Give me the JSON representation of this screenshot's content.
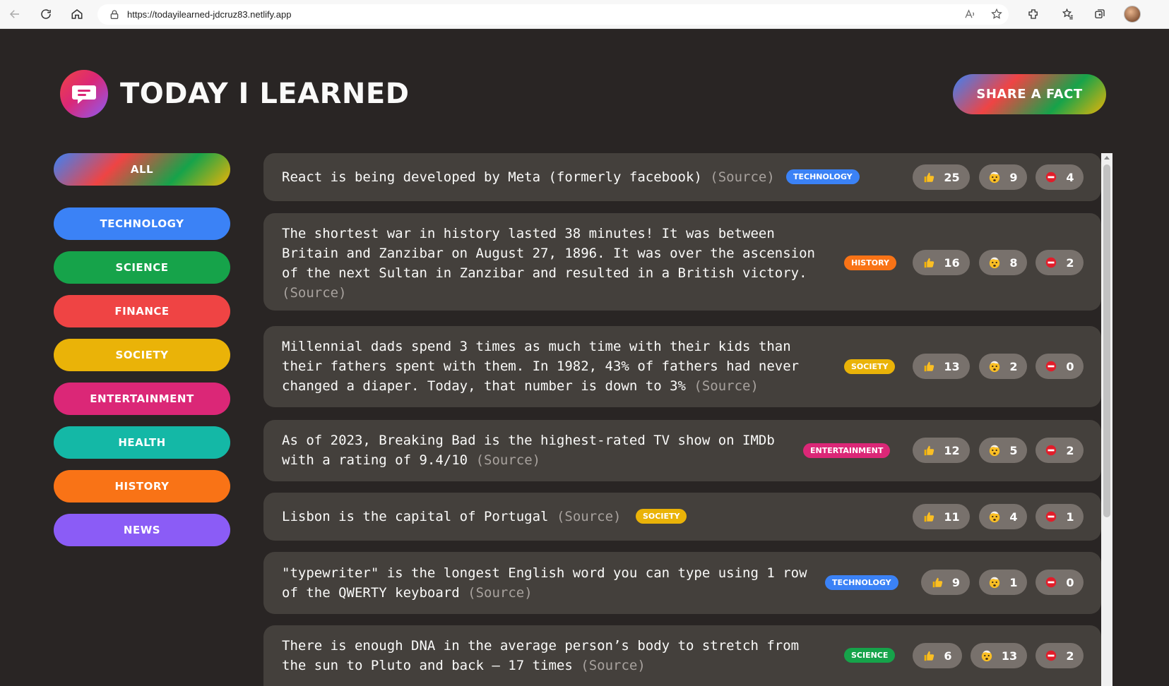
{
  "browser": {
    "url_host": "https://todayilearned-jdcruz83.netlify.app",
    "icons": [
      "back-icon",
      "refresh-icon",
      "home-icon",
      "lock-icon",
      "read-aloud-icon",
      "favorite-add-icon",
      "extensions-icon",
      "favorites-icon",
      "collections-icon",
      "profile-avatar"
    ]
  },
  "header": {
    "title": "TODAY I LEARNED",
    "share_label": "SHARE A FACT"
  },
  "colors": {
    "technology": "#3b82f6",
    "science": "#16a34a",
    "finance": "#ef4444",
    "society": "#eab308",
    "entertainment": "#db2777",
    "health": "#14b8a6",
    "history": "#f97316",
    "news": "#8b5cf6"
  },
  "sidebar": {
    "all_label": "ALL",
    "categories": [
      {
        "label": "TECHNOLOGY",
        "color": "#3b82f6"
      },
      {
        "label": "SCIENCE",
        "color": "#16a34a"
      },
      {
        "label": "FINANCE",
        "color": "#ef4444"
      },
      {
        "label": "SOCIETY",
        "color": "#eab308"
      },
      {
        "label": "ENTERTAINMENT",
        "color": "#db2777"
      },
      {
        "label": "HEALTH",
        "color": "#14b8a6"
      },
      {
        "label": "HISTORY",
        "color": "#f97316"
      },
      {
        "label": "NEWS",
        "color": "#8b5cf6"
      }
    ]
  },
  "facts": [
    {
      "text": "React is being developed by Meta (formerly facebook)",
      "source": "(Source)",
      "tag": "TECHNOLOGY",
      "tag_color": "#3b82f6",
      "votes": {
        "like": "25",
        "mindblown": "9",
        "false": "4"
      }
    },
    {
      "text": "The shortest war in history lasted 38 minutes! It was between Britain and Zanzibar on August 27, 1896. It was over the ascension of the next Sultan in Zanzibar and resulted in a British victory.",
      "source": "(Source)",
      "tag": "HISTORY",
      "tag_color": "#f97316",
      "votes": {
        "like": "16",
        "mindblown": "8",
        "false": "2"
      }
    },
    {
      "text": "Millennial dads spend 3 times as much time with their kids than their fathers spent with them. In 1982, 43% of fathers had never changed a diaper. Today, that number is down to 3%",
      "source": "(Source)",
      "tag": "SOCIETY",
      "tag_color": "#eab308",
      "votes": {
        "like": "13",
        "mindblown": "2",
        "false": "0"
      }
    },
    {
      "text": "As of 2023, Breaking Bad is the highest-rated TV show on IMDb with a rating of 9.4/10",
      "source": "(Source)",
      "tag": "ENTERTAINMENT",
      "tag_color": "#db2777",
      "votes": {
        "like": "12",
        "mindblown": "5",
        "false": "2"
      }
    },
    {
      "text": "Lisbon is the capital of Portugal",
      "source": "(Source)",
      "tag": "SOCIETY",
      "tag_color": "#eab308",
      "votes": {
        "like": "11",
        "mindblown": "4",
        "false": "1"
      }
    },
    {
      "text": "\"typewriter\" is the longest English word you can type using 1 row of the QWERTY keyboard",
      "source": "(Source)",
      "tag": "TECHNOLOGY",
      "tag_color": "#3b82f6",
      "votes": {
        "like": "9",
        "mindblown": "1",
        "false": "0"
      }
    },
    {
      "text": "There is enough DNA in the average person’s body to stretch from the sun to Pluto and back — 17 times",
      "source": "(Source)",
      "tag": "SCIENCE",
      "tag_color": "#16a34a",
      "votes": {
        "like": "6",
        "mindblown": "13",
        "false": "2"
      }
    }
  ]
}
